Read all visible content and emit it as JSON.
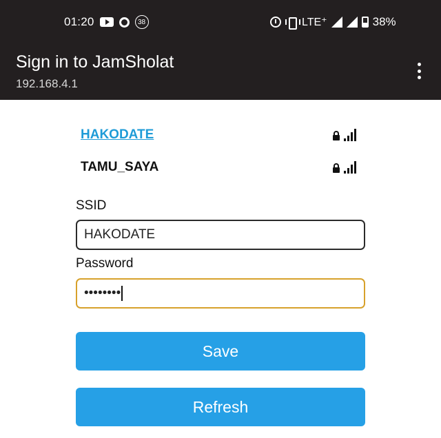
{
  "status_bar": {
    "time": "01:20",
    "notification_count": "38",
    "network": "LTE⁺",
    "battery": "38%"
  },
  "app_bar": {
    "title": "Sign in to JamSholat",
    "subtitle": "192.168.4.1",
    "menu_icon": "more-vert-icon"
  },
  "networks": [
    {
      "ssid": "HAKODATE",
      "selected": true,
      "secured": true
    },
    {
      "ssid": "TAMU_SAYA",
      "selected": false,
      "secured": true
    }
  ],
  "form": {
    "ssid_label": "SSID",
    "ssid_value": "HAKODATE",
    "password_label": "Password",
    "password_value": "••••••••"
  },
  "buttons": {
    "save_label": "Save",
    "refresh_label": "Refresh"
  },
  "colors": {
    "bar_background": "#231f20",
    "link": "#1e9bd7",
    "button": "#26a0e6",
    "focus_border": "#d7a12b"
  }
}
